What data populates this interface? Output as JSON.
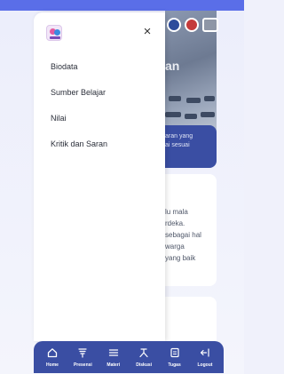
{
  "drawer": {
    "close_symbol": "×",
    "logo_icon": "app-logo-icon",
    "menu": [
      {
        "label": "Biodata"
      },
      {
        "label": "Sumber Belajar"
      },
      {
        "label": "Nilai"
      },
      {
        "label": "Kritik dan Saran"
      }
    ]
  },
  "background": {
    "hero_title_partial": "an",
    "blue_card_lines": [
      "aran yang",
      "ai sesuai"
    ],
    "info_card_lines": [
      "lu mala",
      "rdeka.",
      " sebagai hal",
      "warga",
      "yang baik"
    ]
  },
  "bottom_nav": [
    {
      "label": "Home",
      "icon": "home-icon"
    },
    {
      "label": "Presensi",
      "icon": "presensi-icon"
    },
    {
      "label": "Materi",
      "icon": "materi-icon"
    },
    {
      "label": "Diskusi",
      "icon": "diskusi-icon"
    },
    {
      "label": "Tugas",
      "icon": "tugas-icon"
    },
    {
      "label": "Logout",
      "icon": "logout-icon"
    }
  ],
  "colors": {
    "accent": "#3a4ea3",
    "top_stripe": "#5a6ee8",
    "background": "#f0f1fb"
  }
}
